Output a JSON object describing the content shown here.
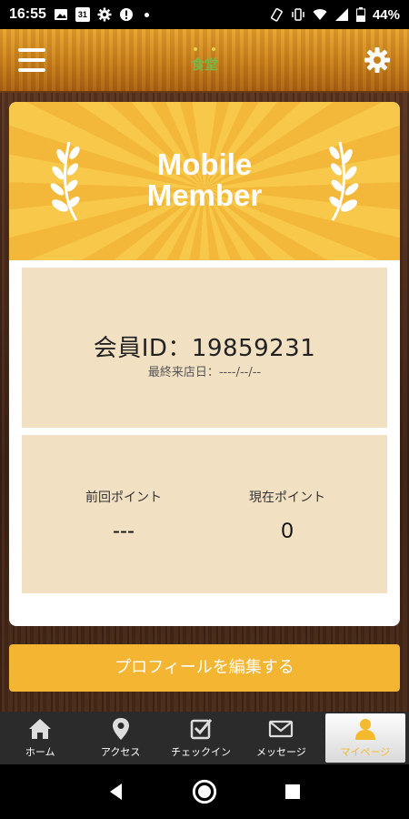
{
  "status_bar": {
    "time": "16:55",
    "battery": "44%",
    "calendar_day": "31"
  },
  "header": {
    "logo_text": "食堂"
  },
  "banner": {
    "line1": "Mobile",
    "line2": "Member"
  },
  "member": {
    "id_label": "会員ID：19859231",
    "last_visit": "最終来店日：----/--/--"
  },
  "points": {
    "previous_label": "前回ポイント",
    "previous_value": "---",
    "current_label": "現在ポイント",
    "current_value": "0"
  },
  "edit_button": "プロフィールを編集する",
  "bottom_nav": {
    "items": [
      {
        "label": "ホーム",
        "icon": "home-icon"
      },
      {
        "label": "アクセス",
        "icon": "location-pin-icon"
      },
      {
        "label": "チェックイン",
        "icon": "checkin-icon"
      },
      {
        "label": "メッセージ",
        "icon": "mail-icon"
      },
      {
        "label": "マイページ",
        "icon": "person-icon",
        "active": true
      }
    ]
  },
  "colors": {
    "accent": "#f3b532",
    "panel": "#f2e0c3"
  }
}
